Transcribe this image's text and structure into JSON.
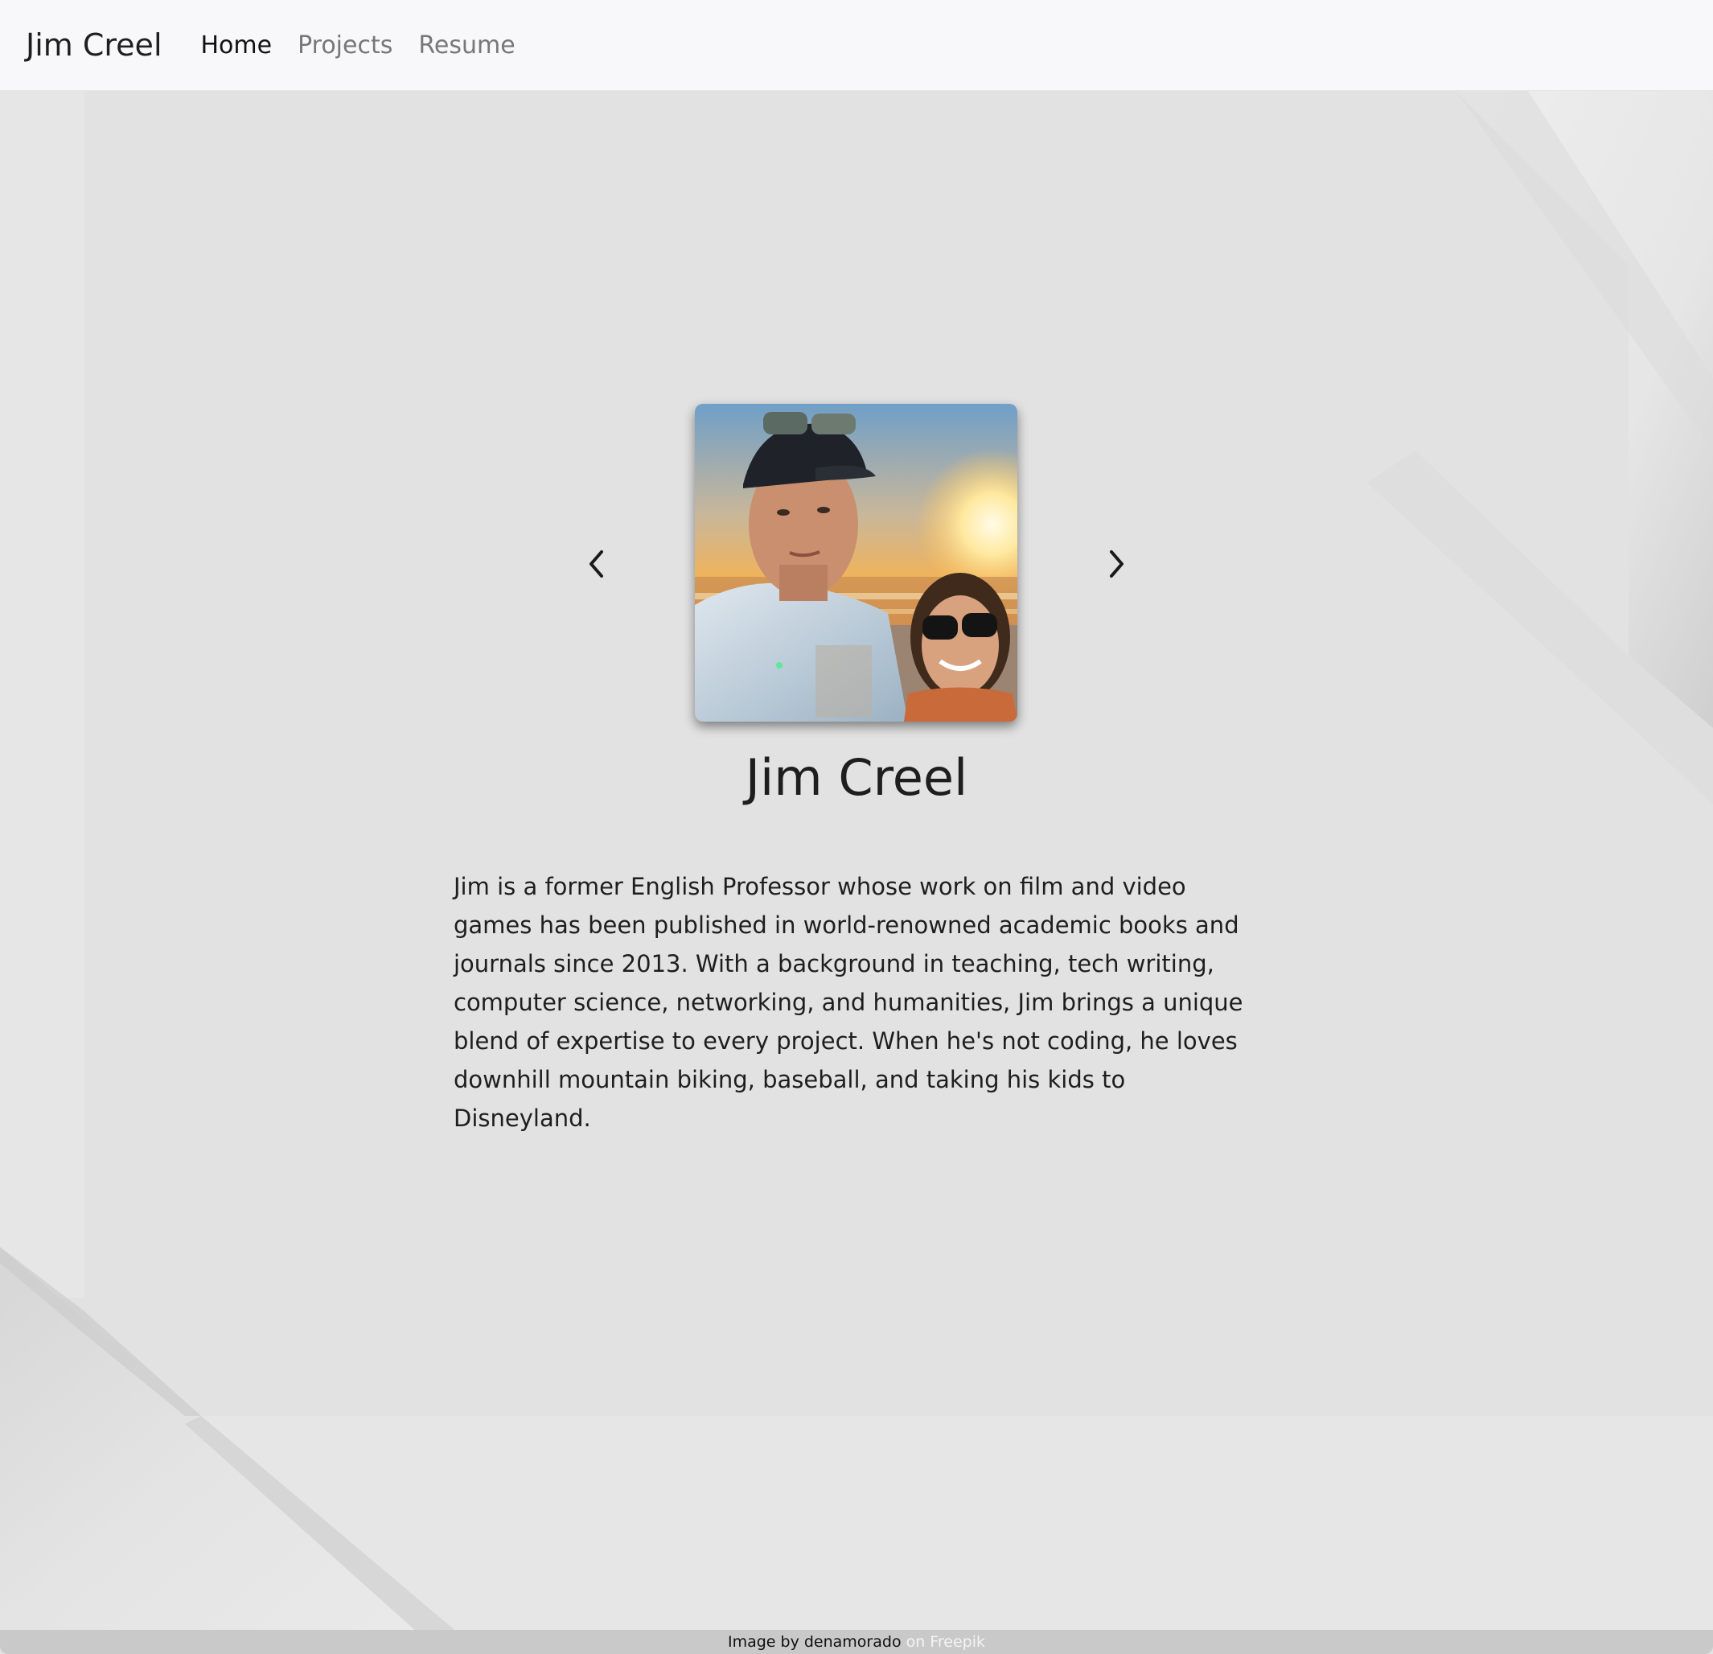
{
  "nav": {
    "brand": "Jim Creel",
    "links": [
      {
        "label": "Home",
        "active": true
      },
      {
        "label": "Projects",
        "active": false
      },
      {
        "label": "Resume",
        "active": false
      }
    ]
  },
  "carousel": {
    "prev_icon": "chevron-left-icon",
    "next_icon": "chevron-right-icon",
    "photo_description_icon": "profile-photo"
  },
  "profile": {
    "name": "Jim Creel",
    "bio": "Jim is a former English Professor whose work on film and video games has been published in world-renowned academic books and journals since 2013. With a background in teaching, tech writing, computer science, networking, and humanities, Jim brings a unique blend of expertise to every project. When he's not coding, he loves downhill mountain biking, baseball, and taking his kids to Disneyland."
  },
  "footer": {
    "credit_prefix": "Image by denamorado",
    "credit_on": "on",
    "credit_link": "Freepik"
  },
  "colors": {
    "background": "#e2e2e2",
    "navbar": "#f8f8fa",
    "footer": "#c9c9c9",
    "text": "#1e1e1e",
    "nav_inactive": "#777777"
  }
}
